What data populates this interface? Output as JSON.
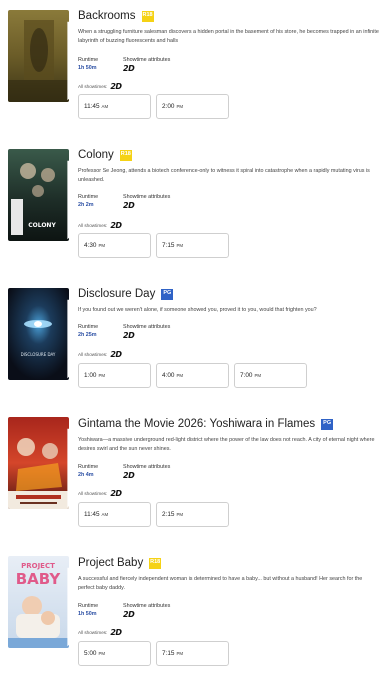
{
  "labels": {
    "runtime": "Runtime",
    "showtime_attributes": "Showtime attributes",
    "all_showtimes": "All showtimes:",
    "format": "2D"
  },
  "colors": {
    "rating_18": "#f5d215",
    "rating_pg": "#2f62c6",
    "runtime_value": "#2a4ea3"
  },
  "movies": [
    {
      "title": "Backrooms",
      "rating": "R18",
      "synopsis": "When a struggling furniture salesman discovers a hidden portal in the basement of his store, he becomes trapped in an infinite labyrinth of buzzing fluorescents and halls",
      "runtime": "1h 50m",
      "poster_icon": "backrooms-poster",
      "showtimes": [
        {
          "time": "11:45",
          "ampm": "AM"
        },
        {
          "time": "2:00",
          "ampm": "PM"
        }
      ]
    },
    {
      "title": "Colony",
      "rating": "R18",
      "synopsis": "Professor Se Jeong, attends a biotech conference-only to witness it spiral into catastrophe when a rapidly mutating virus is unleashed.",
      "runtime": "2h 2m",
      "poster_icon": "colony-poster",
      "poster_text": "COLONY",
      "showtimes": [
        {
          "time": "4:30",
          "ampm": "PM"
        },
        {
          "time": "7:15",
          "ampm": "PM"
        }
      ]
    },
    {
      "title": "Disclosure Day",
      "rating": "PG",
      "synopsis": "If you found out we weren't alone, if someone showed you, proved it to you, would that frighten you?",
      "runtime": "2h 25m",
      "poster_icon": "disclosure-day-poster",
      "poster_text": "DISCLOSURE DAY",
      "showtimes": [
        {
          "time": "1:00",
          "ampm": "PM"
        },
        {
          "time": "4:00",
          "ampm": "PM"
        },
        {
          "time": "7:00",
          "ampm": "PM"
        }
      ]
    },
    {
      "title": "Gintama the Movie 2026: Yoshiwara in Flames",
      "rating": "PG",
      "synopsis": "Yoshiwara—a massive underground red-light district where the power of the law does not reach. A city of eternal night where desires swirl and the sun never shines.",
      "runtime": "2h 4m",
      "poster_icon": "gintama-poster",
      "showtimes": [
        {
          "time": "11:45",
          "ampm": "AM"
        },
        {
          "time": "2:15",
          "ampm": "PM"
        }
      ]
    },
    {
      "title": "Project Baby",
      "rating": "R18",
      "synopsis": "A successful and fiercely independent woman is determined to have a baby... but without a husband! Her search for the perfect baby daddy.",
      "runtime": "1h 50m",
      "poster_icon": "project-baby-poster",
      "poster_text_1": "PROJECT",
      "poster_text_2": "BABY",
      "showtimes": [
        {
          "time": "5:00",
          "ampm": "PM"
        },
        {
          "time": "7:15",
          "ampm": "PM"
        }
      ]
    }
  ]
}
